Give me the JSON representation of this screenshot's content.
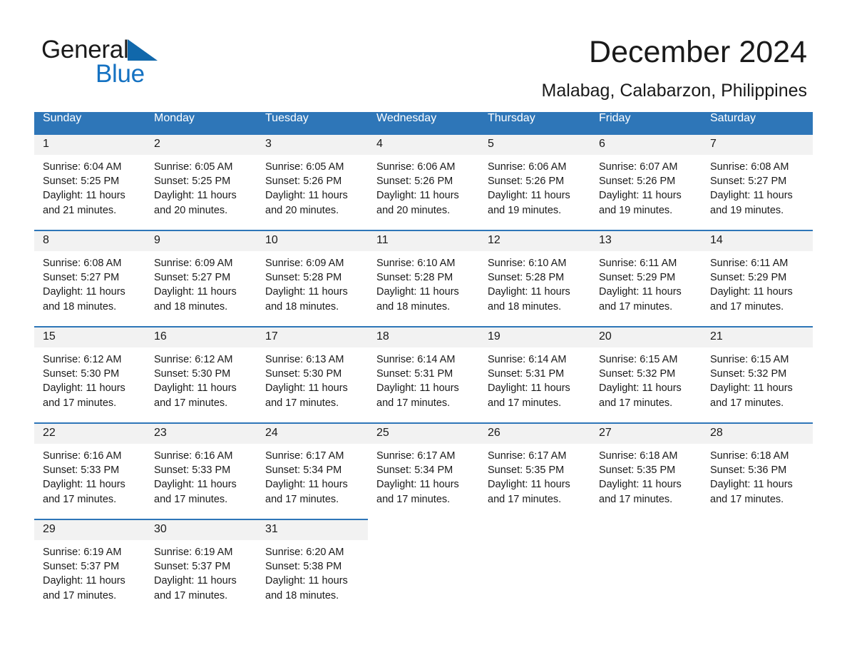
{
  "brand": {
    "name_part1": "General",
    "name_part2": "Blue",
    "accent_color": "#1572c2",
    "triangle_color": "#1168ab",
    "logo_icon": "triangle-logo-icon"
  },
  "header": {
    "title": "December 2024",
    "location": "Malabag, Calabarzon, Philippines"
  },
  "calendar": {
    "header_bg": "#2e76b8",
    "daynum_bg": "#f2f2f2",
    "weekday_headers": [
      "Sunday",
      "Monday",
      "Tuesday",
      "Wednesday",
      "Thursday",
      "Friday",
      "Saturday"
    ],
    "weeks": [
      [
        {
          "day": "1",
          "sunrise": "Sunrise: 6:04 AM",
          "sunset": "Sunset: 5:25 PM",
          "daylight": "Daylight: 11 hours and 21 minutes."
        },
        {
          "day": "2",
          "sunrise": "Sunrise: 6:05 AM",
          "sunset": "Sunset: 5:25 PM",
          "daylight": "Daylight: 11 hours and 20 minutes."
        },
        {
          "day": "3",
          "sunrise": "Sunrise: 6:05 AM",
          "sunset": "Sunset: 5:26 PM",
          "daylight": "Daylight: 11 hours and 20 minutes."
        },
        {
          "day": "4",
          "sunrise": "Sunrise: 6:06 AM",
          "sunset": "Sunset: 5:26 PM",
          "daylight": "Daylight: 11 hours and 20 minutes."
        },
        {
          "day": "5",
          "sunrise": "Sunrise: 6:06 AM",
          "sunset": "Sunset: 5:26 PM",
          "daylight": "Daylight: 11 hours and 19 minutes."
        },
        {
          "day": "6",
          "sunrise": "Sunrise: 6:07 AM",
          "sunset": "Sunset: 5:26 PM",
          "daylight": "Daylight: 11 hours and 19 minutes."
        },
        {
          "day": "7",
          "sunrise": "Sunrise: 6:08 AM",
          "sunset": "Sunset: 5:27 PM",
          "daylight": "Daylight: 11 hours and 19 minutes."
        }
      ],
      [
        {
          "day": "8",
          "sunrise": "Sunrise: 6:08 AM",
          "sunset": "Sunset: 5:27 PM",
          "daylight": "Daylight: 11 hours and 18 minutes."
        },
        {
          "day": "9",
          "sunrise": "Sunrise: 6:09 AM",
          "sunset": "Sunset: 5:27 PM",
          "daylight": "Daylight: 11 hours and 18 minutes."
        },
        {
          "day": "10",
          "sunrise": "Sunrise: 6:09 AM",
          "sunset": "Sunset: 5:28 PM",
          "daylight": "Daylight: 11 hours and 18 minutes."
        },
        {
          "day": "11",
          "sunrise": "Sunrise: 6:10 AM",
          "sunset": "Sunset: 5:28 PM",
          "daylight": "Daylight: 11 hours and 18 minutes."
        },
        {
          "day": "12",
          "sunrise": "Sunrise: 6:10 AM",
          "sunset": "Sunset: 5:28 PM",
          "daylight": "Daylight: 11 hours and 18 minutes."
        },
        {
          "day": "13",
          "sunrise": "Sunrise: 6:11 AM",
          "sunset": "Sunset: 5:29 PM",
          "daylight": "Daylight: 11 hours and 17 minutes."
        },
        {
          "day": "14",
          "sunrise": "Sunrise: 6:11 AM",
          "sunset": "Sunset: 5:29 PM",
          "daylight": "Daylight: 11 hours and 17 minutes."
        }
      ],
      [
        {
          "day": "15",
          "sunrise": "Sunrise: 6:12 AM",
          "sunset": "Sunset: 5:30 PM",
          "daylight": "Daylight: 11 hours and 17 minutes."
        },
        {
          "day": "16",
          "sunrise": "Sunrise: 6:12 AM",
          "sunset": "Sunset: 5:30 PM",
          "daylight": "Daylight: 11 hours and 17 minutes."
        },
        {
          "day": "17",
          "sunrise": "Sunrise: 6:13 AM",
          "sunset": "Sunset: 5:30 PM",
          "daylight": "Daylight: 11 hours and 17 minutes."
        },
        {
          "day": "18",
          "sunrise": "Sunrise: 6:14 AM",
          "sunset": "Sunset: 5:31 PM",
          "daylight": "Daylight: 11 hours and 17 minutes."
        },
        {
          "day": "19",
          "sunrise": "Sunrise: 6:14 AM",
          "sunset": "Sunset: 5:31 PM",
          "daylight": "Daylight: 11 hours and 17 minutes."
        },
        {
          "day": "20",
          "sunrise": "Sunrise: 6:15 AM",
          "sunset": "Sunset: 5:32 PM",
          "daylight": "Daylight: 11 hours and 17 minutes."
        },
        {
          "day": "21",
          "sunrise": "Sunrise: 6:15 AM",
          "sunset": "Sunset: 5:32 PM",
          "daylight": "Daylight: 11 hours and 17 minutes."
        }
      ],
      [
        {
          "day": "22",
          "sunrise": "Sunrise: 6:16 AM",
          "sunset": "Sunset: 5:33 PM",
          "daylight": "Daylight: 11 hours and 17 minutes."
        },
        {
          "day": "23",
          "sunrise": "Sunrise: 6:16 AM",
          "sunset": "Sunset: 5:33 PM",
          "daylight": "Daylight: 11 hours and 17 minutes."
        },
        {
          "day": "24",
          "sunrise": "Sunrise: 6:17 AM",
          "sunset": "Sunset: 5:34 PM",
          "daylight": "Daylight: 11 hours and 17 minutes."
        },
        {
          "day": "25",
          "sunrise": "Sunrise: 6:17 AM",
          "sunset": "Sunset: 5:34 PM",
          "daylight": "Daylight: 11 hours and 17 minutes."
        },
        {
          "day": "26",
          "sunrise": "Sunrise: 6:17 AM",
          "sunset": "Sunset: 5:35 PM",
          "daylight": "Daylight: 11 hours and 17 minutes."
        },
        {
          "day": "27",
          "sunrise": "Sunrise: 6:18 AM",
          "sunset": "Sunset: 5:35 PM",
          "daylight": "Daylight: 11 hours and 17 minutes."
        },
        {
          "day": "28",
          "sunrise": "Sunrise: 6:18 AM",
          "sunset": "Sunset: 5:36 PM",
          "daylight": "Daylight: 11 hours and 17 minutes."
        }
      ],
      [
        {
          "day": "29",
          "sunrise": "Sunrise: 6:19 AM",
          "sunset": "Sunset: 5:37 PM",
          "daylight": "Daylight: 11 hours and 17 minutes."
        },
        {
          "day": "30",
          "sunrise": "Sunrise: 6:19 AM",
          "sunset": "Sunset: 5:37 PM",
          "daylight": "Daylight: 11 hours and 17 minutes."
        },
        {
          "day": "31",
          "sunrise": "Sunrise: 6:20 AM",
          "sunset": "Sunset: 5:38 PM",
          "daylight": "Daylight: 11 hours and 18 minutes."
        },
        {
          "day": "",
          "sunrise": "",
          "sunset": "",
          "daylight": ""
        },
        {
          "day": "",
          "sunrise": "",
          "sunset": "",
          "daylight": ""
        },
        {
          "day": "",
          "sunrise": "",
          "sunset": "",
          "daylight": ""
        },
        {
          "day": "",
          "sunrise": "",
          "sunset": "",
          "daylight": ""
        }
      ]
    ]
  }
}
